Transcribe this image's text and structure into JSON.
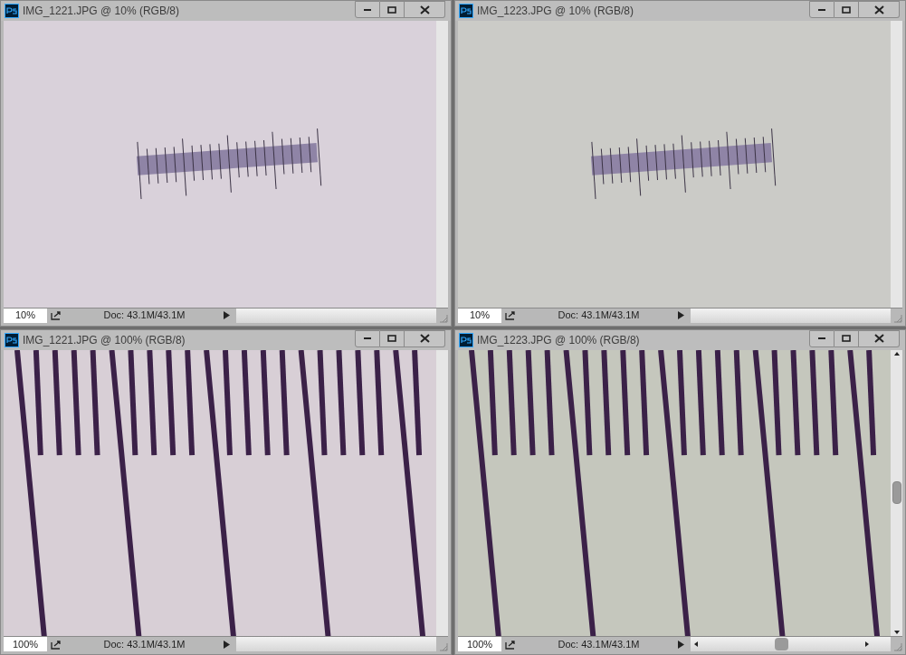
{
  "windows": [
    {
      "title": "IMG_1221.JPG @ 10% (RGB/8)",
      "zoom": "10%",
      "doc": "Doc: 43.1M/43.1M",
      "scrollbars": false
    },
    {
      "title": "IMG_1223.JPG @ 10% (RGB/8)",
      "zoom": "10%",
      "doc": "Doc: 43.1M/43.1M",
      "scrollbars": false
    },
    {
      "title": "IMG_1221.JPG @ 100% (RGB/8)",
      "zoom": "100%",
      "doc": "Doc: 43.1M/43.1M",
      "scrollbars": false
    },
    {
      "title": "IMG_1223.JPG @ 100% (RGB/8)",
      "zoom": "100%",
      "doc": "Doc: 43.1M/43.1M",
      "scrollbars": true
    }
  ]
}
